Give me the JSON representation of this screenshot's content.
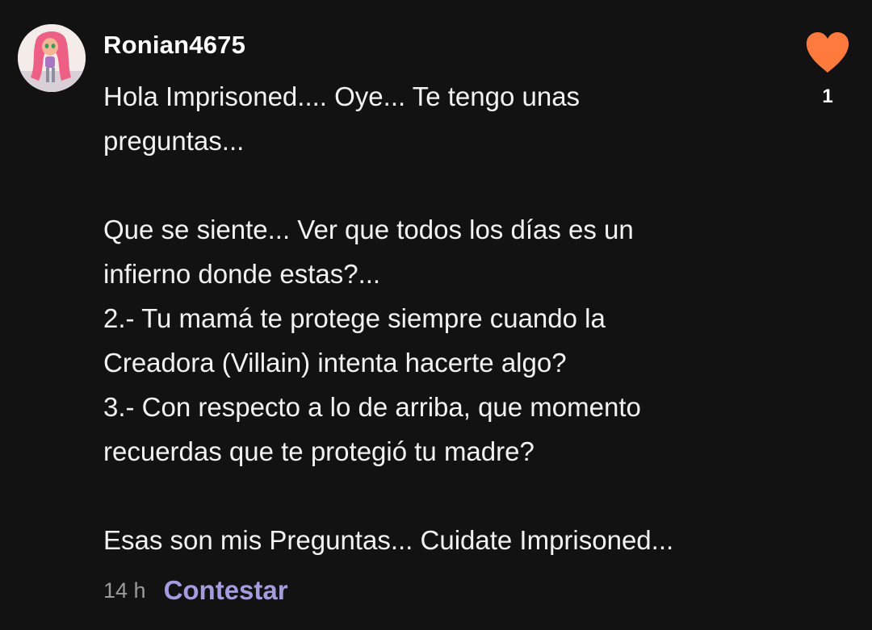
{
  "comment": {
    "username": "Ronian4675",
    "paragraphs": [
      "Hola Imprisoned.... Oye... Te tengo unas\npreguntas...",
      "",
      "Que se siente... Ver que todos los días es un\ninfierno donde estas?...\n2.- Tu mamá te protege siempre cuando la\nCreadora (Villain) intenta hacerte algo?\n3.- Con respecto a lo de arriba, que momento\nrecuerdas que te protegió tu madre?",
      "",
      "Esas son mis Preguntas... Cuidate Imprisoned..."
    ],
    "timestamp": "14 h",
    "reply_label": "Contestar",
    "like_count": "1",
    "like_icon": "heart-icon",
    "avatar_icon": "avatar-image"
  },
  "colors": {
    "background": "#121212",
    "like": "#ff7a3c",
    "reply": "#a59ce0",
    "timestamp": "#9a9a9a"
  }
}
